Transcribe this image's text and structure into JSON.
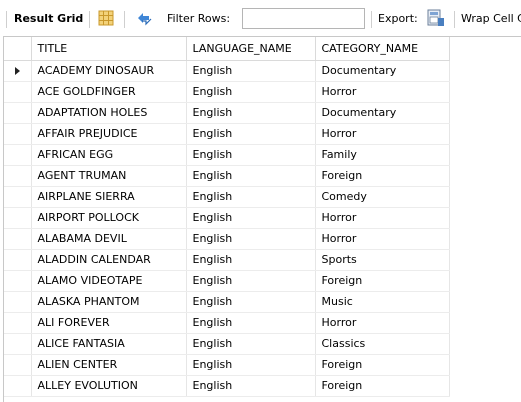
{
  "toolbar": {
    "result_grid_label": "Result Grid",
    "grid_icon": "grid-view-icon",
    "refresh_icon": "refresh-arrows-icon",
    "filter_label": "Filter Rows:",
    "filter_value": "",
    "export_label": "Export:",
    "export_icon": "export-file-icon",
    "wrap_label": "Wrap Cell Content"
  },
  "grid": {
    "columns": [
      "TITLE",
      "LANGUAGE_NAME",
      "CATEGORY_NAME"
    ],
    "selected_row_index": 0,
    "rows": [
      [
        "ACADEMY DINOSAUR",
        "English",
        "Documentary"
      ],
      [
        "ACE GOLDFINGER",
        "English",
        "Horror"
      ],
      [
        "ADAPTATION HOLES",
        "English",
        "Documentary"
      ],
      [
        "AFFAIR PREJUDICE",
        "English",
        "Horror"
      ],
      [
        "AFRICAN EGG",
        "English",
        "Family"
      ],
      [
        "AGENT TRUMAN",
        "English",
        "Foreign"
      ],
      [
        "AIRPLANE SIERRA",
        "English",
        "Comedy"
      ],
      [
        "AIRPORT POLLOCK",
        "English",
        "Horror"
      ],
      [
        "ALABAMA DEVIL",
        "English",
        "Horror"
      ],
      [
        "ALADDIN CALENDAR",
        "English",
        "Sports"
      ],
      [
        "ALAMO VIDEOTAPE",
        "English",
        "Foreign"
      ],
      [
        "ALASKA PHANTOM",
        "English",
        "Music"
      ],
      [
        "ALI FOREVER",
        "English",
        "Horror"
      ],
      [
        "ALICE FANTASIA",
        "English",
        "Classics"
      ],
      [
        "ALIEN CENTER",
        "English",
        "Foreign"
      ],
      [
        "ALLEY EVOLUTION",
        "English",
        "Foreign"
      ]
    ]
  }
}
